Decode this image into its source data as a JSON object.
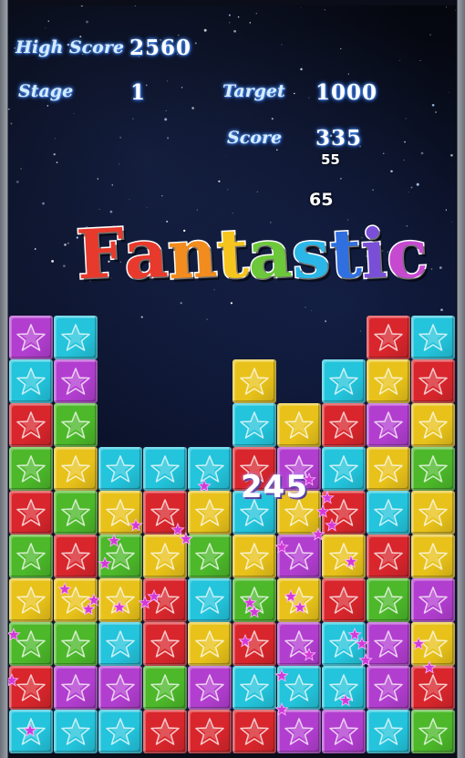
{
  "hud": {
    "high_score_label": "High Score",
    "high_score_value": "2560",
    "stage_label": "Stage",
    "stage_value": "1",
    "target_label": "Target",
    "target_value": "1000",
    "score_label": "Score",
    "score_value": "335"
  },
  "floating_points": [
    "55",
    "65"
  ],
  "combo_points": "245",
  "banner_text": "Fantastic",
  "banner_letter_colors": [
    "#e83a2c",
    "#e83a2c",
    "#f28c1e",
    "#f5c51e",
    "#6cc83a",
    "#2bb6e8",
    "#2f6fe0",
    "#7a4fd8",
    "#c64ad0"
  ],
  "palette": {
    "R": "#d8262c",
    "G": "#4cb82a",
    "B": "#23c4dc",
    "Y": "#e8c21a",
    "P": "#b23ed0"
  },
  "board": [
    [
      "P",
      "B",
      ".",
      ".",
      ".",
      ".",
      ".",
      ".",
      "R",
      "B"
    ],
    [
      "B",
      "P",
      ".",
      ".",
      ".",
      "Y",
      ".",
      "B",
      "Y",
      "R"
    ],
    [
      "R",
      "G",
      ".",
      ".",
      ".",
      "B",
      "Y",
      "R",
      "P",
      "Y"
    ],
    [
      "G",
      "Y",
      "B",
      "B",
      "B",
      "R",
      "P",
      "B",
      "Y",
      "G"
    ],
    [
      "R",
      "G",
      "Y",
      "R",
      "Y",
      "B",
      "Y",
      "R",
      "B",
      "Y"
    ],
    [
      "G",
      "R",
      "G",
      "Y",
      "G",
      "Y",
      "P",
      "Y",
      "R",
      "Y"
    ],
    [
      "Y",
      "Y",
      "Y",
      "R",
      "B",
      "G",
      "Y",
      "R",
      "G",
      "P"
    ],
    [
      "G",
      "G",
      "B",
      "R",
      "Y",
      "R",
      "P",
      "B",
      "P",
      "Y"
    ],
    [
      "R",
      "P",
      "P",
      "G",
      "P",
      "B",
      "B",
      "B",
      "P",
      "R"
    ],
    [
      "B",
      "B",
      "B",
      "R",
      "R",
      "R",
      "P",
      "P",
      "B",
      "G"
    ]
  ]
}
